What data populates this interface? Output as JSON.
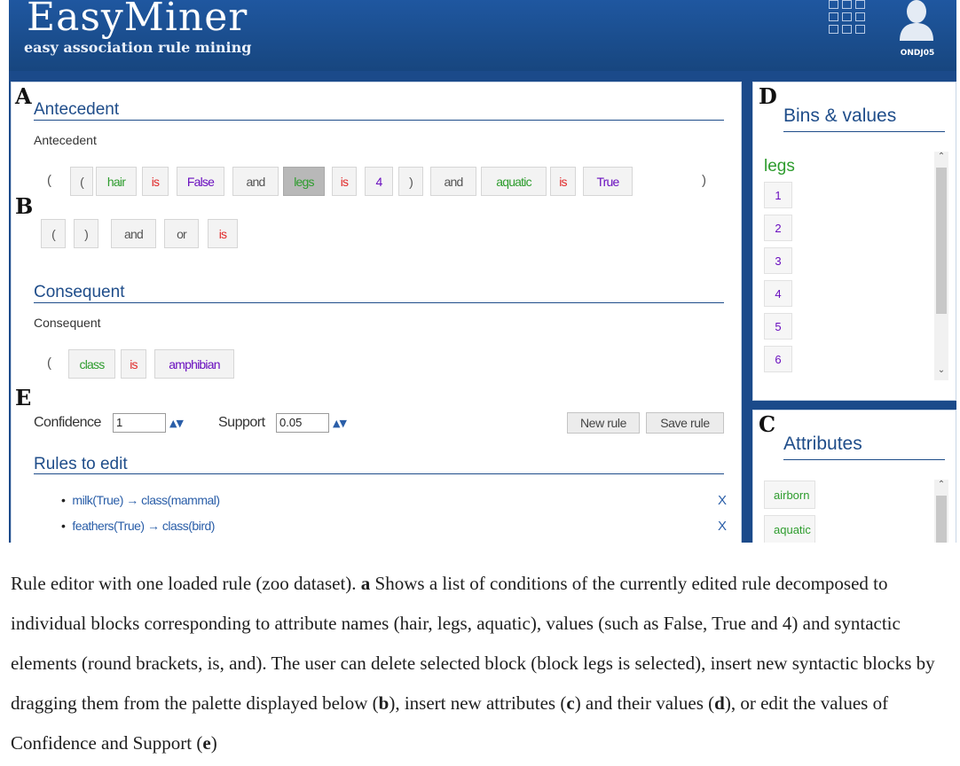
{
  "app": {
    "title": "EasyMiner",
    "tagline": "easy association rule mining",
    "user": "ONDJ05",
    "grid_icon": "apps-grid-icon",
    "user_icon": "user-avatar-icon"
  },
  "labels": {
    "a": "A",
    "b": "B",
    "c": "C",
    "d": "D",
    "e": "E"
  },
  "antecedent": {
    "title": "Antecedent",
    "sub": "Antecedent",
    "blocks": [
      "(",
      "(",
      "hair",
      "is",
      "False",
      "and",
      "legs",
      "is",
      "4",
      ")",
      "and",
      "aquatic",
      "is",
      "True"
    ],
    "close": ")"
  },
  "palette": [
    "(",
    ")",
    "and",
    "or",
    "is"
  ],
  "consequent": {
    "title": "Consequent",
    "sub": "Consequent",
    "open": "(",
    "blocks": [
      "class",
      "is",
      "amphibian"
    ]
  },
  "measures": {
    "confidence_label": "Confidence",
    "confidence_value": "1",
    "support_label": "Support",
    "support_value": "0.05",
    "spinner": "▲▼"
  },
  "buttons": {
    "new_rule": "New rule",
    "save_rule": "Save rule"
  },
  "rules": {
    "title": "Rules to edit",
    "items": [
      "milk(True) → class(mammal)",
      "feathers(True) → class(bird)"
    ],
    "remove": "X"
  },
  "bins": {
    "title": "Bins & values",
    "attribute": "legs",
    "values": [
      "1",
      "2",
      "3",
      "4",
      "5",
      "6"
    ]
  },
  "attributes": {
    "title": "Attributes",
    "items": [
      "airborn",
      "aquatic"
    ]
  },
  "colors": {
    "header": "#1b4a8a",
    "attribute": "#2e9c2e",
    "operator": "#e12b2b",
    "value": "#6a0fbf",
    "link": "#2a5ea8"
  },
  "caption": {
    "lead": "Rule editor with one loaded rule (zoo dataset). ",
    "a_key": "a",
    "a_text": " Shows a list of conditions of the currently edited rule decomposed to individual blocks corresponding to attribute names (hair, legs, aquatic), values (such as False, True and 4) and syntactic elements (round brackets, is, and). The user can delete selected block (block legs is selected), insert new syntactic blocks by dragging them from the palette displayed below (",
    "b_key": "b",
    "b_text": "), insert new attributes (",
    "c_key": "c",
    "c_text": ") and their values (",
    "d_key": "d",
    "d_text": "), or edit the values of Confidence and Support (",
    "e_key": "e",
    "e_text": ")"
  }
}
